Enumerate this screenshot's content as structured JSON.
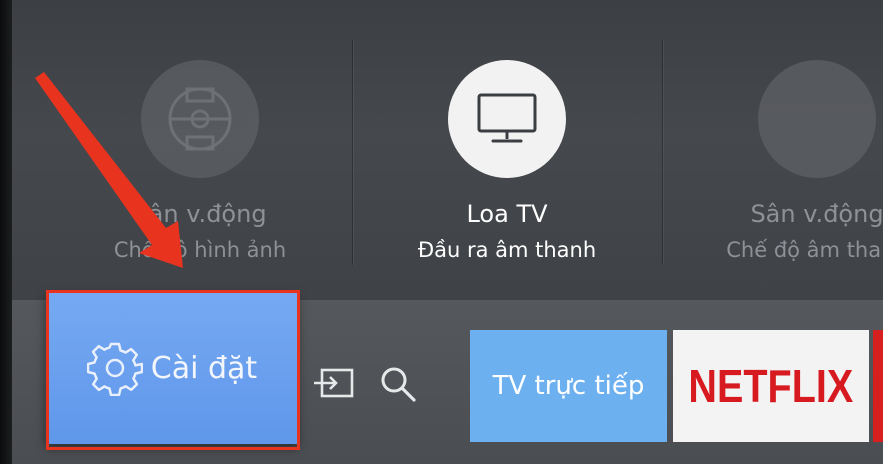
{
  "top_row": [
    {
      "title": "Sân v.động",
      "subtitle": "Chế độ hình ảnh",
      "icon": "stadium-icon"
    },
    {
      "title": "Loa TV",
      "subtitle": "Đầu ra âm thanh",
      "icon": "tv-monitor-icon"
    },
    {
      "title": "Sân v.động",
      "subtitle": "Chế độ âm thanh",
      "icon": "stadium-icon"
    }
  ],
  "bottom_bar": {
    "settings_label": "Cài đặt",
    "settings_icon": "gear-icon",
    "source_icon": "source-input-icon",
    "search_icon": "search-icon",
    "apps": [
      {
        "label": "TV trực tiếp"
      },
      {
        "label": "NETFLIX"
      }
    ]
  },
  "colors": {
    "accent_blue": "#6aa2f0",
    "highlight_red": "#e8331f",
    "netflix_red": "#d71920"
  }
}
